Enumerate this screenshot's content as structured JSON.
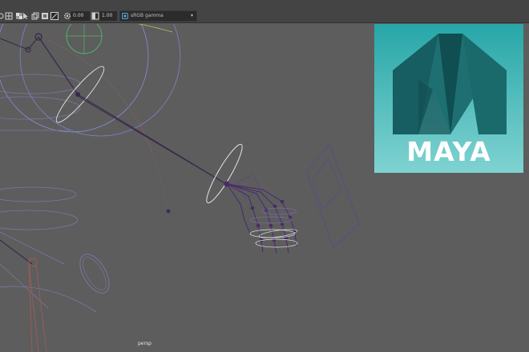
{
  "toolbar": {
    "exposure_value": "0.00",
    "gamma_value": "1.00",
    "color_space": "sRGB gamma",
    "icons": [
      "select-arrow-icon",
      "grid-toggle-icon",
      "texture-icon",
      "wireframe-icon",
      "image-plane-icon",
      "gear-icon",
      "exposure-icon",
      "gamma-icon"
    ]
  },
  "viewport": {
    "camera_name": "persp",
    "colors": {
      "background": "#5d5d5d",
      "joint_purple": "#4a2a6a",
      "bone_dark": "#3a2a4a",
      "control_white": "#e8e8e8",
      "control_blue": "#7c83c8",
      "control_yellow": "#b8b85a",
      "control_green": "#4fb86a",
      "control_red": "#b35a5a",
      "plane_purple": "#5b4a86"
    }
  },
  "logo": {
    "text": "MAYA",
    "color_top": "#27a6a8",
    "color_bottom": "#7fd3d1"
  }
}
